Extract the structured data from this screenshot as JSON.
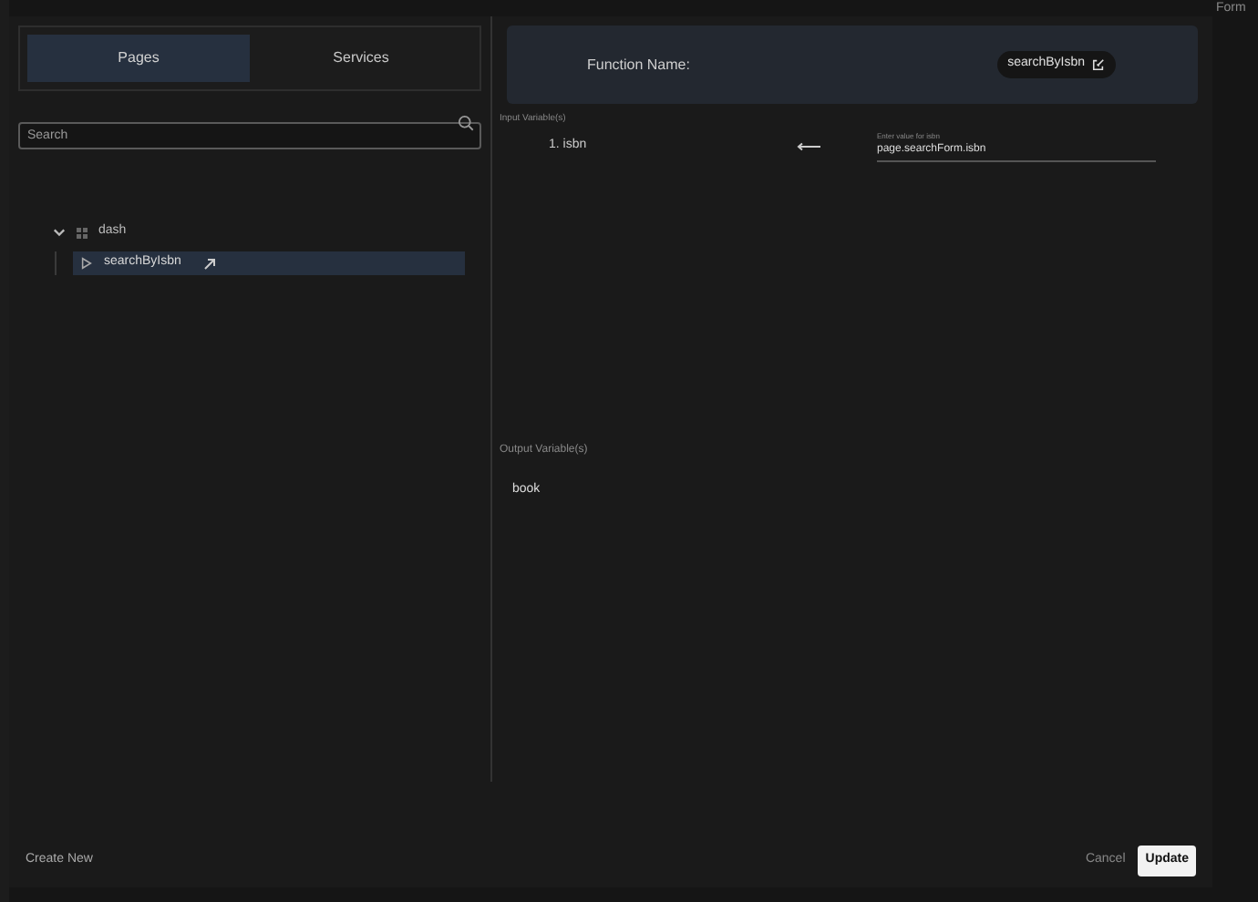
{
  "background": {
    "side_label": "Form"
  },
  "tabs": [
    {
      "label": "Pages",
      "selected": true
    },
    {
      "label": "Services",
      "selected": false
    }
  ],
  "search": {
    "placeholder": "Search"
  },
  "tree": [
    {
      "label": "dash",
      "expanded": true,
      "children": [
        {
          "label": "searchByIsbn",
          "selected": true
        }
      ]
    }
  ],
  "function": {
    "label": "Function Name:",
    "name": "searchByIsbn"
  },
  "inputs": {
    "title": "Input Variable(s)",
    "items": [
      {
        "label": "1. isbn",
        "field_label": "Enter value for isbn",
        "value": "page.searchForm.isbn"
      }
    ]
  },
  "outputs": {
    "title": "Output Variable(s)",
    "items": [
      "book"
    ]
  },
  "footer": {
    "create": "Create New",
    "cancel": "Cancel",
    "update": "Update"
  }
}
